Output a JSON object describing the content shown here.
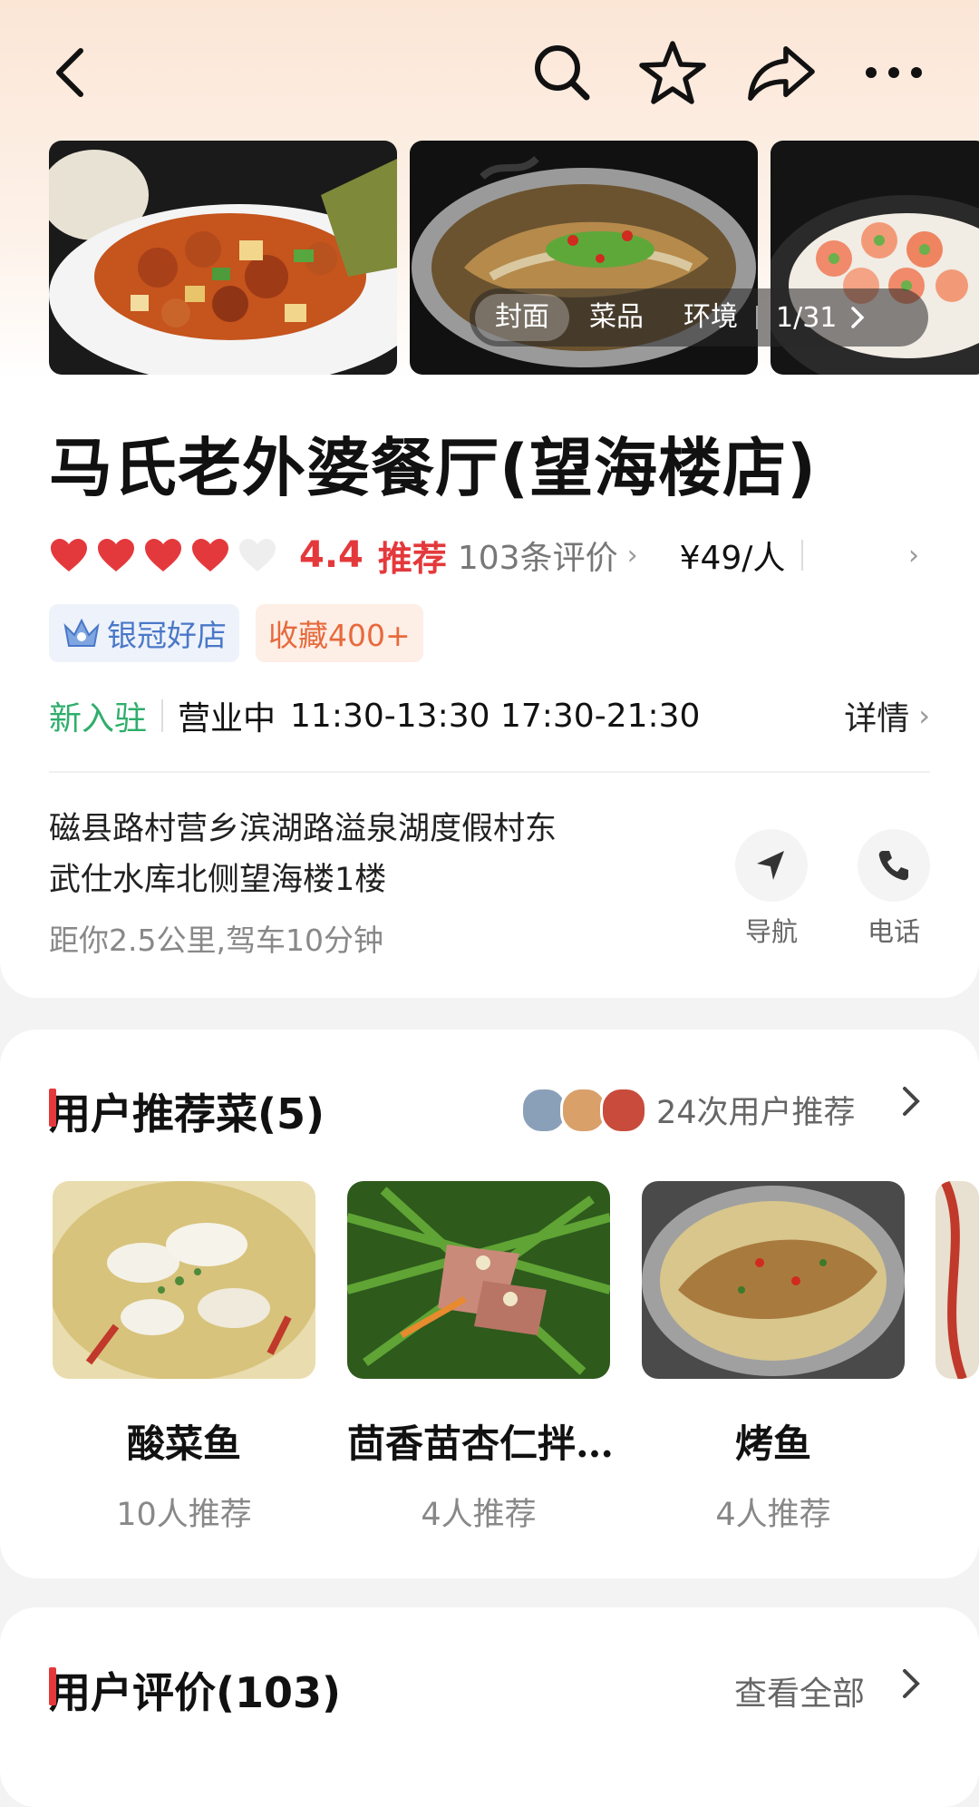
{
  "gallery": {
    "tabs": [
      "封面",
      "菜品",
      "环境"
    ],
    "counter": "1/31"
  },
  "shop": {
    "name": "马氏老外婆餐厅(望海楼店)",
    "hearts_filled": 4,
    "hearts_total": 5,
    "score": "4.4",
    "recommend_label": "推荐",
    "review_count_label": "103条评价",
    "price": "¥49/人",
    "badges": [
      "银冠好店",
      "收藏400+"
    ],
    "new_label": "新入驻",
    "status": "营业中",
    "hours": "11:30-13:30 17:30-21:30",
    "detail_label": "详情",
    "address_line1": "磁县路村营乡滨湖路溢泉湖度假村东",
    "address_line2": "武仕水库北侧望海楼1楼",
    "distance": "距你2.5公里,驾车10分钟",
    "nav_label": "导航",
    "phone_label": "电话"
  },
  "recommend": {
    "title": "用户推荐菜(5)",
    "summary": "24次用户推荐",
    "dishes": [
      {
        "name": "酸菜鱼",
        "count": "10人推荐"
      },
      {
        "name": "茴香苗杏仁拌…",
        "count": "4人推荐"
      },
      {
        "name": "烤鱼",
        "count": "4人推荐"
      }
    ]
  },
  "reviews": {
    "title": "用户评价(103)",
    "see_all": "查看全部"
  },
  "colors": {
    "accent": "#e4393c",
    "new_green": "#2fae6b",
    "badge_blue": "#4a78c8",
    "badge_orange": "#e76a3c"
  }
}
